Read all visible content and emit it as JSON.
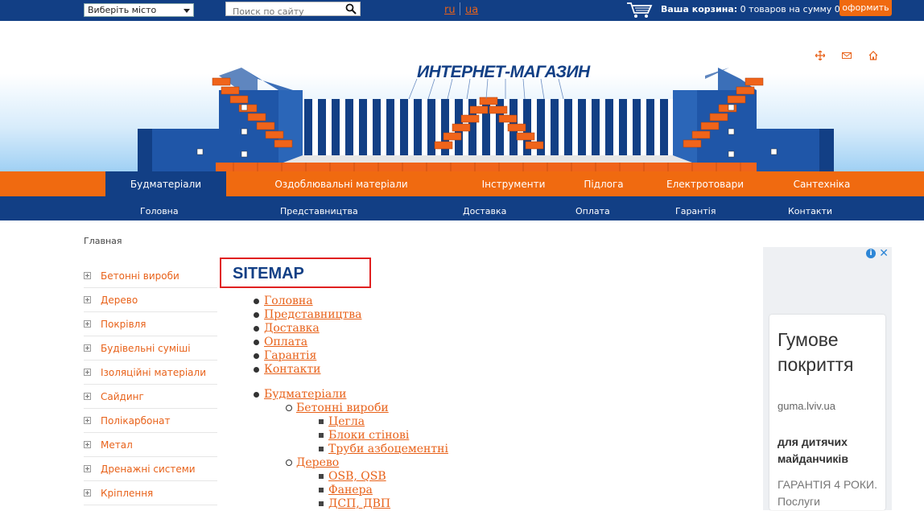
{
  "topbar": {
    "city_select": "Виберіть місто",
    "search_placeholder": "Поиск по сайту",
    "lang_ru": "ru",
    "lang_ua": "ua",
    "cart_label": "Ваша корзина:",
    "cart_summary": "0 товаров на сумму 0 грн",
    "order_button": "оформить"
  },
  "header": {
    "logo_text": "ИНТЕРНЕТ-МАГАЗИН"
  },
  "nav_primary": [
    {
      "label": "Будматеріали",
      "active": true
    },
    {
      "label": "Оздоблювальні матеріали"
    },
    {
      "label": "Інструменти"
    },
    {
      "label": "Підлога"
    },
    {
      "label": "Електротовари"
    },
    {
      "label": "Сантехніка"
    }
  ],
  "nav_secondary": [
    "Головна",
    "Представництва",
    "Доставка",
    "Оплата",
    "Гарантія",
    "Контакти"
  ],
  "breadcrumb": "Главная",
  "sidebar": [
    "Бетонні вироби",
    "Дерево",
    "Покрівля",
    "Будівельні суміші",
    "Ізоляційні матеріали",
    "Сайдинг",
    "Полікарбонат",
    "Метал",
    "Дренажні системи",
    "Кріплення"
  ],
  "sitemap": {
    "title": "SITEMAP",
    "top_links": [
      "Головна",
      "Представництва",
      "Доставка",
      "Оплата",
      "Гарантія",
      "Контакти"
    ],
    "category": "Будматеріали",
    "sub1": "Бетонні вироби",
    "sub1_items": [
      "Цегла",
      "Блоки стінові",
      "Труби азбоцементні"
    ],
    "sub2": "Дерево",
    "sub2_items": [
      "OSB, QSB",
      "Фанера",
      "ДСП, ДВП"
    ]
  },
  "ad": {
    "headline": "Гумове покриття",
    "domain": "guma.lviv.ua",
    "subhead": "для дитячих майданчиків",
    "body": "ГАРАНТІЯ 4 РОКИ. Послуги"
  },
  "colors": {
    "brand_blue": "#123f85",
    "brand_orange": "#f06a10",
    "link_orange": "#e8621a"
  }
}
